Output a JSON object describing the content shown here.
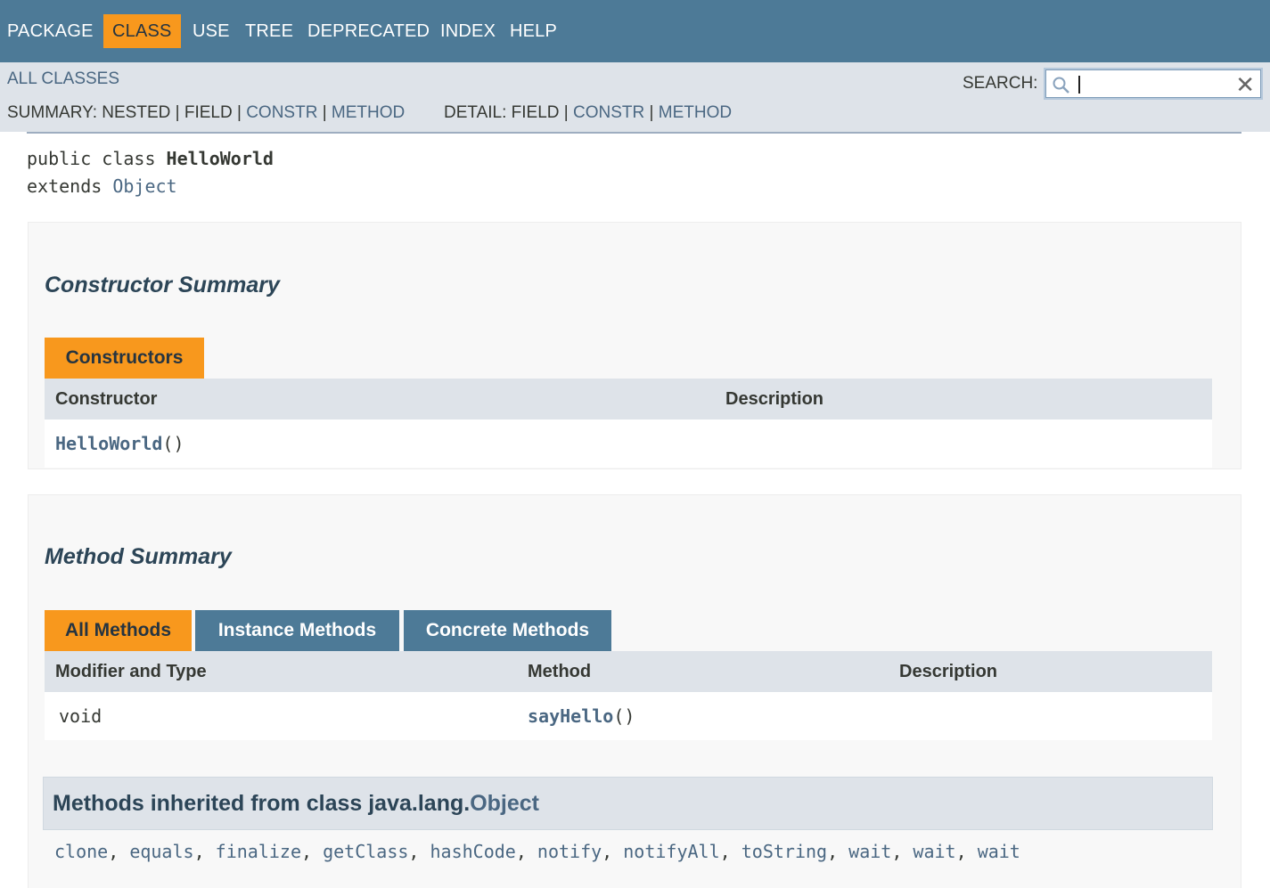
{
  "topnav": {
    "items": [
      {
        "label": "PACKAGE",
        "active": false
      },
      {
        "label": "CLASS",
        "active": true
      },
      {
        "label": "USE",
        "active": false
      },
      {
        "label": "TREE",
        "active": false
      },
      {
        "label": "DEPRECATED",
        "active": false
      },
      {
        "label": "INDEX",
        "active": false
      },
      {
        "label": "HELP",
        "active": false
      }
    ]
  },
  "subnav": {
    "all_classes": "ALL CLASSES",
    "summary_prefix": "SUMMARY: NESTED | FIELD | ",
    "summary_constr": "CONSTR",
    "summary_sep": " | ",
    "summary_method": "METHOD",
    "detail_prefix": "DETAIL: FIELD | ",
    "detail_constr": "CONSTR",
    "detail_sep": " | ",
    "detail_method": "METHOD",
    "search_label": "SEARCH:",
    "search_value": ""
  },
  "declaration": {
    "line1_prefix": "public class ",
    "class_name": "HelloWorld",
    "line2_prefix": "extends ",
    "superclass": "Object"
  },
  "constructor_summary": {
    "title": "Constructor Summary",
    "tab": "Constructors",
    "columns": [
      "Constructor",
      "Description"
    ],
    "rows": [
      {
        "name": "HelloWorld",
        "params": "()",
        "description": ""
      }
    ]
  },
  "method_summary": {
    "title": "Method Summary",
    "tabs": [
      {
        "label": "All Methods",
        "active": true
      },
      {
        "label": "Instance Methods",
        "active": false
      },
      {
        "label": "Concrete Methods",
        "active": false
      }
    ],
    "columns": [
      "Modifier and Type",
      "Method",
      "Description"
    ],
    "rows": [
      {
        "type": "void",
        "name": "sayHello",
        "params": "()",
        "description": ""
      }
    ]
  },
  "inherited": {
    "prefix": "Methods inherited from class java.lang.",
    "class_link": "Object",
    "methods": [
      "clone",
      "equals",
      "finalize",
      "getClass",
      "hashCode",
      "notify",
      "notifyAll",
      "toString",
      "wait",
      "wait",
      "wait"
    ]
  },
  "colors": {
    "nav_bg": "#4d7a97",
    "accent": "#f8981d",
    "subnav_bg": "#dee3e9",
    "link": "#4a6782"
  }
}
